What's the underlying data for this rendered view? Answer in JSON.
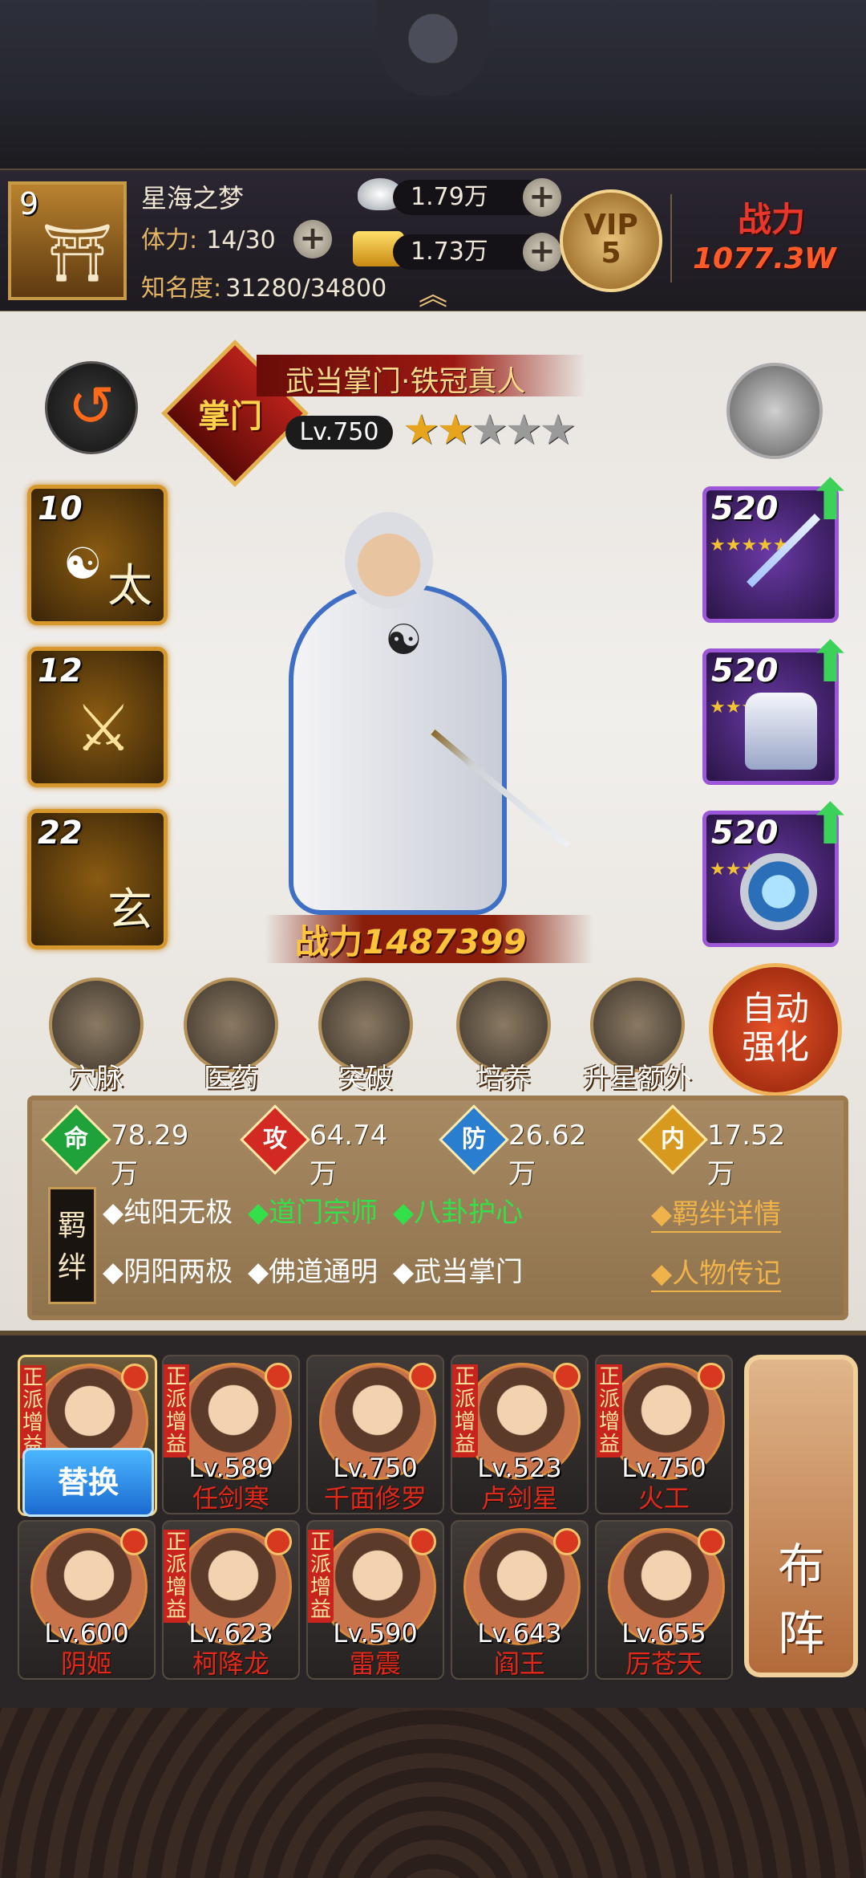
{
  "player": {
    "level": "9",
    "name": "星海之梦",
    "stamina_label": "体力:",
    "stamina_value": "14/30",
    "fame_label": "知名度:",
    "fame_value": "31280/34800"
  },
  "currency": {
    "silver": "1.79万",
    "gold": "1.73万"
  },
  "vip": {
    "label": "VIP",
    "level": "5"
  },
  "power_top": {
    "label": "战力",
    "value": "1077.3W"
  },
  "hero": {
    "rank_badge": "掌门",
    "title": "武当掌门·铁冠真人",
    "level": "Lv.750",
    "stars_filled": 2,
    "stars_total": 5,
    "power_label": "战力",
    "power_value": "1487399"
  },
  "skills": [
    {
      "level": "10",
      "glyph": "太"
    },
    {
      "level": "12",
      "glyph": ""
    },
    {
      "level": "22",
      "glyph": "玄"
    }
  ],
  "equipment": [
    {
      "level": "520",
      "stars": 5
    },
    {
      "level": "520",
      "stars": 5
    },
    {
      "level": "520",
      "stars": 5
    }
  ],
  "functions": [
    "穴脉",
    "医药",
    "突破",
    "培养",
    "升星额外"
  ],
  "auto_enhance": {
    "line1": "自动",
    "line2": "强化"
  },
  "stats": [
    {
      "icon": "命",
      "value": "78.29万",
      "color": "#1fa23a"
    },
    {
      "icon": "攻",
      "value": "64.74万",
      "color": "#d22a22"
    },
    {
      "icon": "防",
      "value": "26.62万",
      "color": "#2a7ed0"
    },
    {
      "icon": "内",
      "value": "17.52万",
      "color": "#d79a1f"
    }
  ],
  "bonds": {
    "label_top": "羁",
    "label_bottom": "绊",
    "row1": [
      {
        "text": "◆纯阳无极",
        "active": false
      },
      {
        "text": "◆道门宗师",
        "active": true
      },
      {
        "text": "◆八卦护心",
        "active": true
      }
    ],
    "row2": [
      {
        "text": "◆阴阳两极",
        "active": false
      },
      {
        "text": "◆佛道通明",
        "active": false
      },
      {
        "text": "◆武当掌门",
        "active": false
      }
    ],
    "link_details": "◆羁绊详情",
    "link_bio": "◆人物传记"
  },
  "replace_button": "替换",
  "faction_tag": "正派增益",
  "formation_button": {
    "line1": "布",
    "line2": "阵"
  },
  "roster": [
    {
      "level": "",
      "name": "",
      "tag": true,
      "selected": true
    },
    {
      "level": "Lv.589",
      "name": "任剑寒",
      "tag": true
    },
    {
      "level": "Lv.750",
      "name": "千面修罗",
      "tag": false
    },
    {
      "level": "Lv.523",
      "name": "卢剑星",
      "tag": true
    },
    {
      "level": "Lv.750",
      "name": "火工",
      "tag": true
    },
    {
      "level": "Lv.600",
      "name": "阴姬",
      "tag": false
    },
    {
      "level": "Lv.623",
      "name": "柯降龙",
      "tag": true
    },
    {
      "level": "Lv.590",
      "name": "雷震",
      "tag": true
    },
    {
      "level": "Lv.643",
      "name": "阎王",
      "tag": false
    },
    {
      "level": "Lv.655",
      "name": "厉苍天",
      "tag": false
    }
  ]
}
